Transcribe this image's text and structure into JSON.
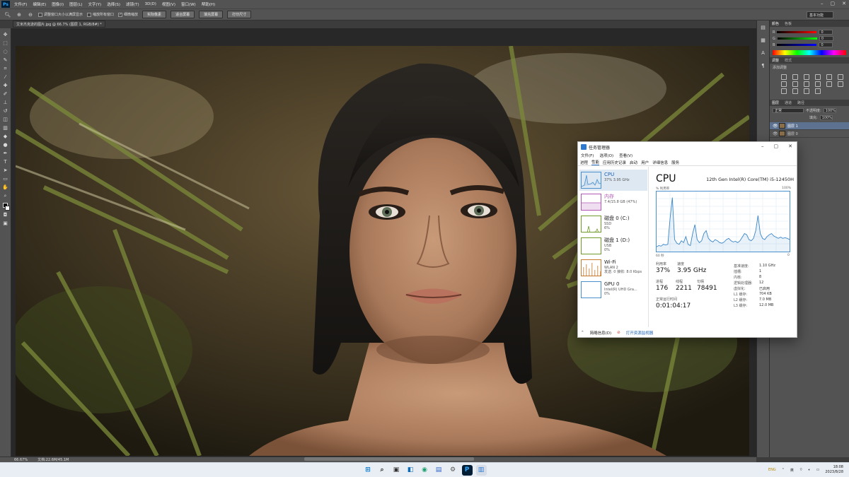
{
  "photoshop": {
    "logo": "Ps",
    "menus": [
      "文件(F)",
      "编辑(E)",
      "图像(I)",
      "图层(L)",
      "文字(Y)",
      "选择(S)",
      "滤镜(T)",
      "3D(D)",
      "视图(V)",
      "窗口(W)",
      "帮助(H)"
    ],
    "options": {
      "chk1": "调整窗口大小以满屏显示",
      "chk2": "缩放所有窗口",
      "chk3": "细微缩放",
      "btn1": "实际像素",
      "btn2": "适合屏幕",
      "btn3": "填充屏幕",
      "btn4": "打印尺寸"
    },
    "workspace": "基本功能",
    "doc_tab": "艾米杰克逊的图片.jpg @ 66.7% (图层 1, RGB/8#) *",
    "status": {
      "zoom": "66.67%",
      "doc": "文档:22.6M/45.1M"
    },
    "color_panel": {
      "tabs": [
        "颜色",
        "色板"
      ],
      "channels": [
        {
          "label": "R",
          "value": "0",
          "color": "#d23b3b"
        },
        {
          "label": "G",
          "value": "0",
          "color": "#3bb34a"
        },
        {
          "label": "B",
          "value": "0",
          "color": "#3b5bd2"
        }
      ]
    },
    "adjust_panel": {
      "tabs": [
        "调整",
        "样式"
      ],
      "hint": "添加调整"
    },
    "layers_panel": {
      "tabs": [
        "图层",
        "通道",
        "路径"
      ],
      "kind": "正常",
      "opacity_label": "不透明度:",
      "opacity": "100%",
      "fill_label": "填充:",
      "fill": "100%",
      "layers": [
        {
          "name": "图层 1",
          "selected": true
        },
        {
          "name": "图层 0",
          "selected": false
        }
      ]
    }
  },
  "task_manager": {
    "title": "任务管理器",
    "menus": [
      "文件(F)",
      "选项(O)",
      "查看(V)"
    ],
    "tabs": [
      "进程",
      "性能",
      "应用历史记录",
      "启动",
      "用户",
      "详细信息",
      "服务"
    ],
    "resources": [
      {
        "name": "CPU",
        "sub1": "37% 3.95 GHz",
        "sub2": "",
        "color": "#4a90cc"
      },
      {
        "name": "内存",
        "sub1": "7.4/15.8 GB (47%)",
        "sub2": "",
        "color": "#b157b5"
      },
      {
        "name": "磁盘 0 (C:)",
        "sub1": "SSD",
        "sub2": "6%",
        "color": "#6f9a2a"
      },
      {
        "name": "磁盘 1 (D:)",
        "sub1": "USB",
        "sub2": "0%",
        "color": "#6f9a2a"
      },
      {
        "name": "Wi-Fi",
        "sub1": "WLAN 2",
        "sub2": "发送: 0 接收: 8.0 Kbps",
        "color": "#c87a2c"
      },
      {
        "name": "GPU 0",
        "sub1": "Intel(R) UHD Gra...",
        "sub2": "0%",
        "color": "#4a90cc"
      }
    ],
    "cpu": {
      "title": "CPU",
      "model": "12th Gen Intel(R) Core(TM) i5-12450H",
      "util_label": "% 利用率",
      "max_label": "100%",
      "time_left": "60 秒",
      "time_right": "0",
      "stats": [
        {
          "label": "利用率",
          "value": "37%"
        },
        {
          "label": "速度",
          "value": "3.95 GHz"
        },
        {
          "label": "进程",
          "value": "176"
        },
        {
          "label": "线程",
          "value": "2211"
        },
        {
          "label": "句柄",
          "value": "78491"
        },
        {
          "label": "正常运行时间",
          "value": "0:01:04:17"
        }
      ],
      "specs": [
        {
          "k": "基准速度:",
          "v": "1.10 GHz"
        },
        {
          "k": "插槽:",
          "v": "1"
        },
        {
          "k": "内核:",
          "v": "8"
        },
        {
          "k": "逻辑处理器:",
          "v": "12"
        },
        {
          "k": "虚拟化:",
          "v": "已启用"
        },
        {
          "k": "L1 缓存:",
          "v": "704 KB"
        },
        {
          "k": "L2 缓存:",
          "v": "7.0 MB"
        },
        {
          "k": "L3 缓存:",
          "v": "12.0 MB"
        }
      ],
      "graph_values": [
        8,
        10,
        9,
        12,
        11,
        12,
        55,
        90,
        20,
        14,
        12,
        18,
        15,
        25,
        12,
        10,
        30,
        45,
        20,
        15,
        18,
        30,
        35,
        22,
        18,
        16,
        20,
        18,
        15,
        14,
        16,
        20,
        22,
        18,
        16,
        17,
        15,
        18,
        24,
        30,
        28,
        20,
        18,
        22,
        35,
        60,
        30,
        22,
        20,
        25,
        28,
        30,
        26,
        24,
        22,
        24,
        22,
        23,
        22,
        20
      ]
    },
    "footer": {
      "less": "简略信息(D)",
      "open": "打开资源监视器"
    }
  },
  "taskbar": {
    "apps": [
      "windows",
      "search",
      "taskview",
      "widgets",
      "edge",
      "store",
      "settings",
      "photoshop",
      "taskmgr"
    ],
    "lang": "ENG",
    "lang2": "英",
    "time": "18:08",
    "date": "2023/8/28"
  }
}
